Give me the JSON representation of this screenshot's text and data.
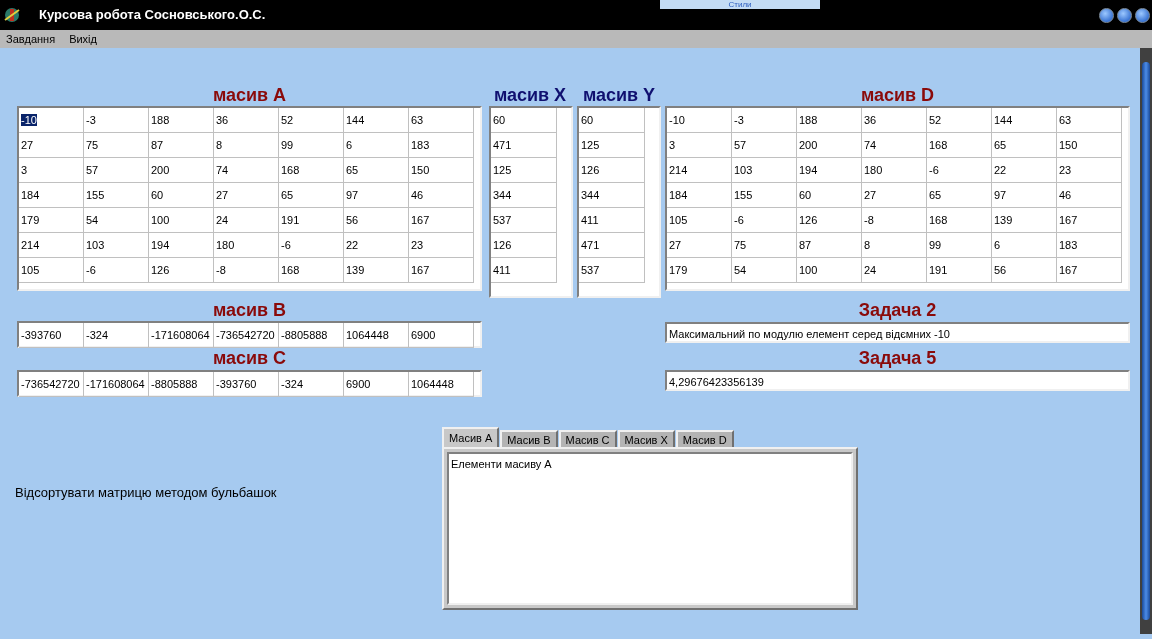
{
  "window": {
    "title": "Курсова робота Сосновського.О.С.",
    "background_window_text": "Стили"
  },
  "menu": [
    "Завдання",
    "Вихід"
  ],
  "grid_a": {
    "title": "масив A",
    "first_cell_selected": true,
    "rows": [
      [
        "-10",
        "-3",
        "188",
        "36",
        "52",
        "144",
        "63"
      ],
      [
        "27",
        "75",
        "87",
        "8",
        "99",
        "6",
        "183"
      ],
      [
        "3",
        "57",
        "200",
        "74",
        "168",
        "65",
        "150"
      ],
      [
        "184",
        "155",
        "60",
        "27",
        "65",
        "97",
        "46"
      ],
      [
        "179",
        "54",
        "100",
        "24",
        "191",
        "56",
        "167"
      ],
      [
        "214",
        "103",
        "194",
        "180",
        "-6",
        "22",
        "23"
      ],
      [
        "105",
        "-6",
        "126",
        "-8",
        "168",
        "139",
        "167"
      ]
    ]
  },
  "grid_x": {
    "title": "масив X",
    "values": [
      "60",
      "471",
      "125",
      "344",
      "537",
      "126",
      "411"
    ]
  },
  "grid_y": {
    "title": "масив Y",
    "values": [
      "60",
      "125",
      "126",
      "344",
      "411",
      "471",
      "537"
    ]
  },
  "grid_d": {
    "title": "масив D",
    "rows": [
      [
        "-10",
        "-3",
        "188",
        "36",
        "52",
        "144",
        "63"
      ],
      [
        "3",
        "57",
        "200",
        "74",
        "168",
        "65",
        "150"
      ],
      [
        "214",
        "103",
        "194",
        "180",
        "-6",
        "22",
        "23"
      ],
      [
        "184",
        "155",
        "60",
        "27",
        "65",
        "97",
        "46"
      ],
      [
        "105",
        "-6",
        "126",
        "-8",
        "168",
        "139",
        "167"
      ],
      [
        "27",
        "75",
        "87",
        "8",
        "99",
        "6",
        "183"
      ],
      [
        "179",
        "54",
        "100",
        "24",
        "191",
        "56",
        "167"
      ]
    ]
  },
  "grid_b": {
    "title": "масив B",
    "values": [
      "-393760",
      "-324",
      "-171608064",
      "-736542720",
      "-8805888",
      "1064448",
      "6900"
    ]
  },
  "grid_c": {
    "title": "масив C",
    "values": [
      "-736542720",
      "-171608064",
      "-8805888",
      "-393760",
      "-324",
      "6900",
      "1064448"
    ]
  },
  "task2": {
    "title": "Задача 2",
    "value": "Максимальний по модулю елемент серед відємних -10"
  },
  "task5": {
    "title": "Задача 5",
    "value": "4,29676423356139"
  },
  "sort_label": "Відсортувати матрицю методом бульбашок",
  "tabs": [
    {
      "label": "Масив A",
      "selected": true
    },
    {
      "label": "Масив B",
      "selected": false
    },
    {
      "label": "Масив C",
      "selected": false
    },
    {
      "label": "Масив X",
      "selected": false
    },
    {
      "label": "Масив D",
      "selected": false
    }
  ],
  "memo": {
    "text": "Елементи масиву A"
  }
}
